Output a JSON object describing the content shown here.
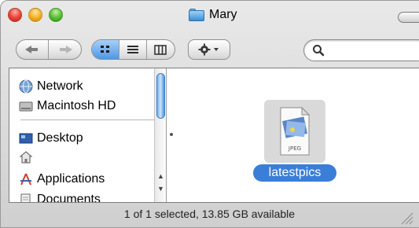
{
  "window": {
    "title": "Mary",
    "accent": "#3b7ed8"
  },
  "toolbar": {
    "nav": [
      "back-icon",
      "forward-icon"
    ],
    "views": [
      {
        "icon": "icon-view-icon",
        "active": true
      },
      {
        "icon": "list-view-icon",
        "active": false
      },
      {
        "icon": "column-view-icon",
        "active": false
      }
    ],
    "action_icon": "gear-icon",
    "search_placeholder": ""
  },
  "sidebar": {
    "items": [
      {
        "label": "Network",
        "icon": "network-globe-icon"
      },
      {
        "label": "Macintosh HD",
        "icon": "hard-drive-icon"
      },
      {
        "label": "Desktop",
        "icon": "desktop-icon"
      },
      {
        "label": "",
        "icon": "home-icon"
      },
      {
        "label": "Applications",
        "icon": "applications-icon"
      },
      {
        "label": "Documents",
        "icon": "documents-icon"
      }
    ]
  },
  "file": {
    "name": "latestpics",
    "type_badge": "JPEG",
    "selected": true
  },
  "status": {
    "text": "1 of 1 selected, 13.85 GB available"
  }
}
